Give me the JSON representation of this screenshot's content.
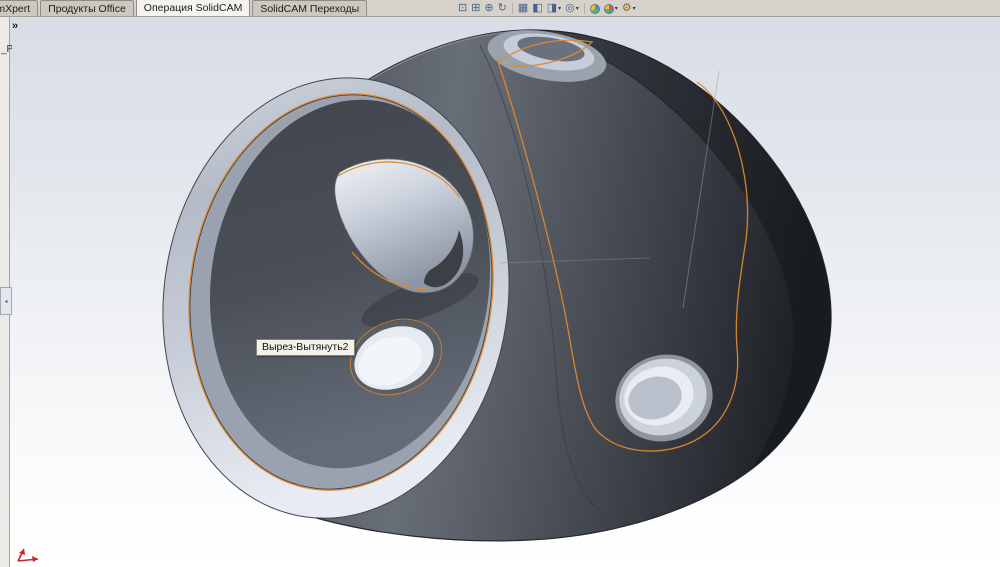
{
  "tab_bar": {
    "tabs": [
      {
        "label": "imXpert",
        "active": false
      },
      {
        "label": "Продукты Office",
        "active": false
      },
      {
        "label": "Операция SolidCAM",
        "active": true
      },
      {
        "label": "SolidCAM Переходы",
        "active": false
      }
    ]
  },
  "toolbar": {
    "caret": "▾",
    "icons": [
      {
        "name": "zoom-to-fit-icon",
        "glyph": "⊡"
      },
      {
        "name": "zoom-to-area-icon",
        "glyph": "⊞"
      },
      {
        "name": "zoom-in-out-icon",
        "glyph": "⊕"
      },
      {
        "name": "rotate-view-icon",
        "glyph": "↻"
      },
      {
        "name": "view-orientation-icon",
        "glyph": "▦"
      },
      {
        "name": "section-view-icon",
        "glyph": "◧"
      },
      {
        "name": "display-style-icon",
        "glyph": "◨"
      },
      {
        "name": "hide-show-items-icon",
        "glyph": "◎"
      },
      {
        "name": "apply-scene-icon",
        "glyph": ""
      },
      {
        "name": "edit-appearance-icon",
        "glyph": ""
      },
      {
        "name": "view-settings-icon",
        "glyph": "⚙"
      }
    ]
  },
  "left_panel": {
    "expand_chevron": "»",
    "partial_label": "_Pr",
    "grip_glyph": "◂"
  },
  "viewport": {
    "tooltip": "Вырез-Вытянуть2"
  },
  "colors": {
    "selection_orange": "#e2882c",
    "model_dark": "#4a4f57",
    "model_silver": "#c9cfda",
    "background_top": "#d7dce5",
    "background_bottom": "#ffffff"
  }
}
